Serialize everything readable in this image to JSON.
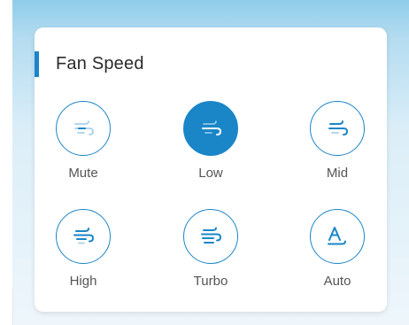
{
  "panel": {
    "title": "Fan Speed",
    "accent_color": "#1a86c8",
    "selected": "Low"
  },
  "options": [
    {
      "label": "Mute",
      "icon": "wind-mute-icon",
      "active": false
    },
    {
      "label": "Low",
      "icon": "wind-low-icon",
      "active": true
    },
    {
      "label": "Mid",
      "icon": "wind-mid-icon",
      "active": false
    },
    {
      "label": "High",
      "icon": "wind-high-icon",
      "active": false
    },
    {
      "label": "Turbo",
      "icon": "wind-turbo-icon",
      "active": false
    },
    {
      "label": "Auto",
      "icon": "auto-a-icon",
      "active": false
    }
  ]
}
